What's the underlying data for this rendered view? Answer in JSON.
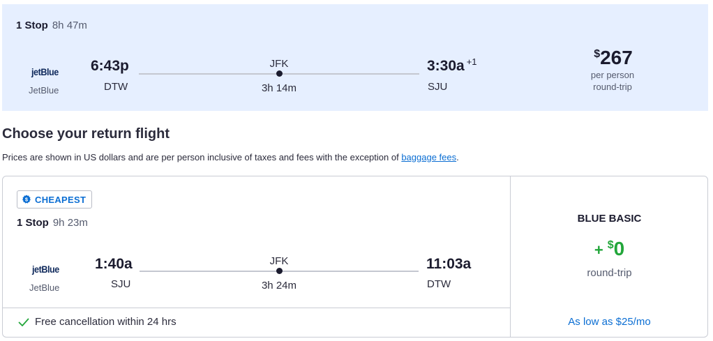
{
  "outbound": {
    "stops": "1 Stop",
    "duration": "8h 47m",
    "airline_logo": "jetBlue",
    "airline_name": "JetBlue",
    "depart_time": "6:43p",
    "depart_code": "DTW",
    "stop_code": "JFK",
    "layover": "3h 14m",
    "arrive_time": "3:30a",
    "arrive_offset": "+1",
    "arrive_code": "SJU",
    "price_currency": "$",
    "price": "267",
    "price_sub1": "per person",
    "price_sub2": "round-trip"
  },
  "heading": "Choose your return flight",
  "note": {
    "text": "Prices are shown in US dollars and are per person inclusive of taxes and fees with the exception of ",
    "link": "baggage fees",
    "end": "."
  },
  "return": {
    "badge": "CHEAPEST",
    "stops": "1 Stop",
    "duration": "9h 23m",
    "airline_logo": "jetBlue",
    "airline_name": "JetBlue",
    "depart_time": "1:40a",
    "depart_code": "SJU",
    "stop_code": "JFK",
    "layover": "3h 24m",
    "arrive_time": "11:03a",
    "arrive_code": "DTW",
    "cancellation": "Free cancellation within 24 hrs"
  },
  "fare": {
    "name": "BLUE BASIC",
    "plus": "+",
    "currency": "$",
    "amount": "0",
    "sub": "round-trip",
    "as_low_as": "As low as $25/mo"
  },
  "colors": {
    "outbound_bg": "#e6efff",
    "accent_blue": "#0b6ed3",
    "price_green": "#22a63a"
  },
  "icons": {
    "badge": "dollar-badge-icon",
    "cancellation": "check-icon"
  }
}
